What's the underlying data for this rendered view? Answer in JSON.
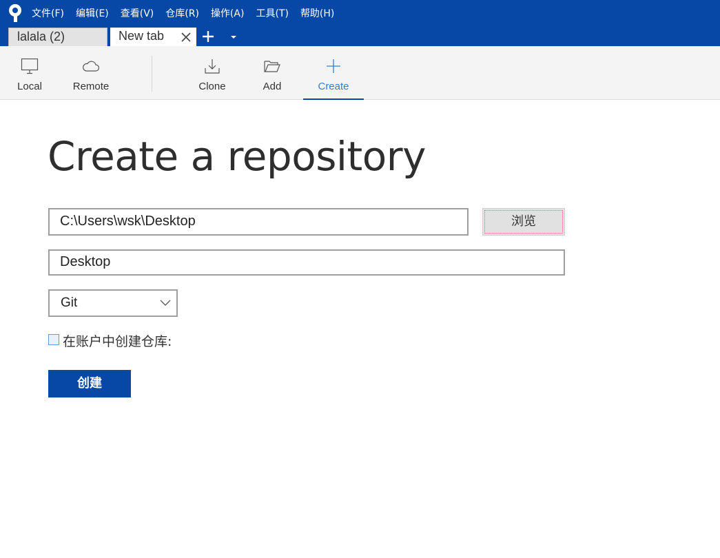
{
  "app": {
    "logo_icon": "sourcetree-logo-icon",
    "brand_color": "#0747a6"
  },
  "menu": {
    "items": [
      {
        "label": "文件(F)"
      },
      {
        "label": "编辑(E)"
      },
      {
        "label": "查看(V)"
      },
      {
        "label": "仓库(R)"
      },
      {
        "label": "操作(A)"
      },
      {
        "label": "工具(T)"
      },
      {
        "label": "帮助(H)"
      }
    ]
  },
  "tabs": {
    "items": [
      {
        "label": "lalala (2)",
        "active": false
      },
      {
        "label": "New tab",
        "active": true,
        "close_icon": "close-icon"
      }
    ],
    "add_icon": "plus-icon",
    "menu_icon": "caret-down-icon"
  },
  "toolbar": {
    "local": {
      "label": "Local",
      "icon": "monitor-icon"
    },
    "remote": {
      "label": "Remote",
      "icon": "cloud-icon"
    },
    "clone": {
      "label": "Clone",
      "icon": "download-icon"
    },
    "add": {
      "label": "Add",
      "icon": "folder-open-icon"
    },
    "create": {
      "label": "Create",
      "icon": "plus-icon",
      "active": true
    },
    "active_color": "#2f7fd6"
  },
  "form": {
    "title": "Create a repository",
    "destination_path": "C:\\Users\\wsk\\Desktop",
    "browse_label": "浏览",
    "name": "Desktop",
    "vcs_type": "Git",
    "create_in_account_label": "在账户中创建仓库:",
    "create_in_account_checked": false,
    "create_label": "创建"
  }
}
